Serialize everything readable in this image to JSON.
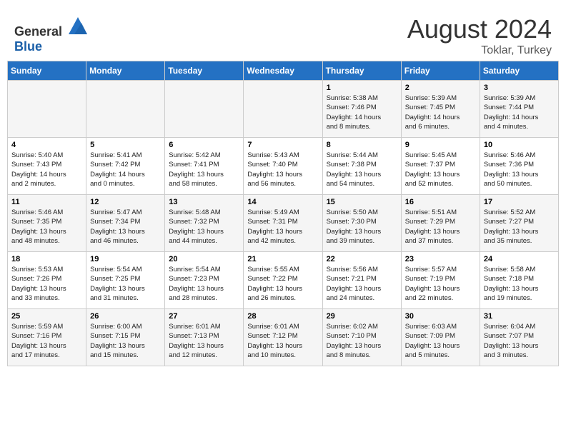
{
  "header": {
    "logo_general": "General",
    "logo_blue": "Blue",
    "month": "August 2024",
    "location": "Toklar, Turkey"
  },
  "weekdays": [
    "Sunday",
    "Monday",
    "Tuesday",
    "Wednesday",
    "Thursday",
    "Friday",
    "Saturday"
  ],
  "weeks": [
    [
      {
        "day": "",
        "info": ""
      },
      {
        "day": "",
        "info": ""
      },
      {
        "day": "",
        "info": ""
      },
      {
        "day": "",
        "info": ""
      },
      {
        "day": "1",
        "info": "Sunrise: 5:38 AM\nSunset: 7:46 PM\nDaylight: 14 hours\nand 8 minutes."
      },
      {
        "day": "2",
        "info": "Sunrise: 5:39 AM\nSunset: 7:45 PM\nDaylight: 14 hours\nand 6 minutes."
      },
      {
        "day": "3",
        "info": "Sunrise: 5:39 AM\nSunset: 7:44 PM\nDaylight: 14 hours\nand 4 minutes."
      }
    ],
    [
      {
        "day": "4",
        "info": "Sunrise: 5:40 AM\nSunset: 7:43 PM\nDaylight: 14 hours\nand 2 minutes."
      },
      {
        "day": "5",
        "info": "Sunrise: 5:41 AM\nSunset: 7:42 PM\nDaylight: 14 hours\nand 0 minutes."
      },
      {
        "day": "6",
        "info": "Sunrise: 5:42 AM\nSunset: 7:41 PM\nDaylight: 13 hours\nand 58 minutes."
      },
      {
        "day": "7",
        "info": "Sunrise: 5:43 AM\nSunset: 7:40 PM\nDaylight: 13 hours\nand 56 minutes."
      },
      {
        "day": "8",
        "info": "Sunrise: 5:44 AM\nSunset: 7:38 PM\nDaylight: 13 hours\nand 54 minutes."
      },
      {
        "day": "9",
        "info": "Sunrise: 5:45 AM\nSunset: 7:37 PM\nDaylight: 13 hours\nand 52 minutes."
      },
      {
        "day": "10",
        "info": "Sunrise: 5:46 AM\nSunset: 7:36 PM\nDaylight: 13 hours\nand 50 minutes."
      }
    ],
    [
      {
        "day": "11",
        "info": "Sunrise: 5:46 AM\nSunset: 7:35 PM\nDaylight: 13 hours\nand 48 minutes."
      },
      {
        "day": "12",
        "info": "Sunrise: 5:47 AM\nSunset: 7:34 PM\nDaylight: 13 hours\nand 46 minutes."
      },
      {
        "day": "13",
        "info": "Sunrise: 5:48 AM\nSunset: 7:32 PM\nDaylight: 13 hours\nand 44 minutes."
      },
      {
        "day": "14",
        "info": "Sunrise: 5:49 AM\nSunset: 7:31 PM\nDaylight: 13 hours\nand 42 minutes."
      },
      {
        "day": "15",
        "info": "Sunrise: 5:50 AM\nSunset: 7:30 PM\nDaylight: 13 hours\nand 39 minutes."
      },
      {
        "day": "16",
        "info": "Sunrise: 5:51 AM\nSunset: 7:29 PM\nDaylight: 13 hours\nand 37 minutes."
      },
      {
        "day": "17",
        "info": "Sunrise: 5:52 AM\nSunset: 7:27 PM\nDaylight: 13 hours\nand 35 minutes."
      }
    ],
    [
      {
        "day": "18",
        "info": "Sunrise: 5:53 AM\nSunset: 7:26 PM\nDaylight: 13 hours\nand 33 minutes."
      },
      {
        "day": "19",
        "info": "Sunrise: 5:54 AM\nSunset: 7:25 PM\nDaylight: 13 hours\nand 31 minutes."
      },
      {
        "day": "20",
        "info": "Sunrise: 5:54 AM\nSunset: 7:23 PM\nDaylight: 13 hours\nand 28 minutes."
      },
      {
        "day": "21",
        "info": "Sunrise: 5:55 AM\nSunset: 7:22 PM\nDaylight: 13 hours\nand 26 minutes."
      },
      {
        "day": "22",
        "info": "Sunrise: 5:56 AM\nSunset: 7:21 PM\nDaylight: 13 hours\nand 24 minutes."
      },
      {
        "day": "23",
        "info": "Sunrise: 5:57 AM\nSunset: 7:19 PM\nDaylight: 13 hours\nand 22 minutes."
      },
      {
        "day": "24",
        "info": "Sunrise: 5:58 AM\nSunset: 7:18 PM\nDaylight: 13 hours\nand 19 minutes."
      }
    ],
    [
      {
        "day": "25",
        "info": "Sunrise: 5:59 AM\nSunset: 7:16 PM\nDaylight: 13 hours\nand 17 minutes."
      },
      {
        "day": "26",
        "info": "Sunrise: 6:00 AM\nSunset: 7:15 PM\nDaylight: 13 hours\nand 15 minutes."
      },
      {
        "day": "27",
        "info": "Sunrise: 6:01 AM\nSunset: 7:13 PM\nDaylight: 13 hours\nand 12 minutes."
      },
      {
        "day": "28",
        "info": "Sunrise: 6:01 AM\nSunset: 7:12 PM\nDaylight: 13 hours\nand 10 minutes."
      },
      {
        "day": "29",
        "info": "Sunrise: 6:02 AM\nSunset: 7:10 PM\nDaylight: 13 hours\nand 8 minutes."
      },
      {
        "day": "30",
        "info": "Sunrise: 6:03 AM\nSunset: 7:09 PM\nDaylight: 13 hours\nand 5 minutes."
      },
      {
        "day": "31",
        "info": "Sunrise: 6:04 AM\nSunset: 7:07 PM\nDaylight: 13 hours\nand 3 minutes."
      }
    ]
  ]
}
